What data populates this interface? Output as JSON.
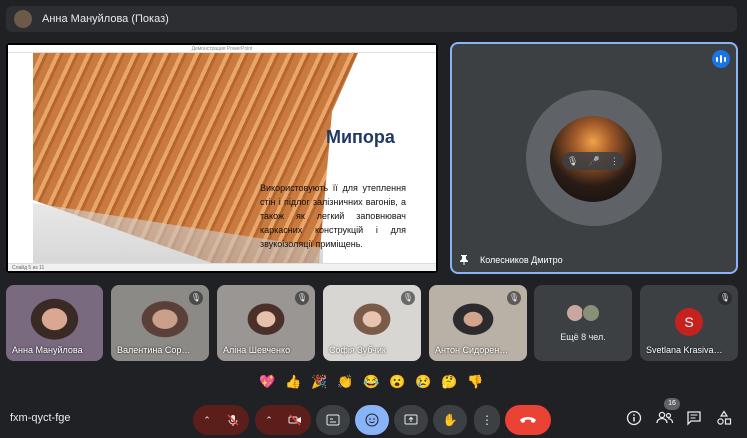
{
  "topbar": {
    "title": "Анна Мануйлова (Показ)"
  },
  "presentation": {
    "window_title": "Демонстрация PowerPoint",
    "slide_title": "Мипора",
    "slide_text": "Використовують її для утеплення стін і підлог залізничних вагонів, а також як легкий заповнювач каркасних конструкцій і для звукоізоляції приміщень.",
    "status_text": "Слайд 5 из 11"
  },
  "speaker": {
    "name": "Колесников Дмитро"
  },
  "participants": [
    {
      "name": "Анна Мануйлова",
      "muted": false
    },
    {
      "name": "Валентина Сор…",
      "muted": true
    },
    {
      "name": "Аліна Шевченко",
      "muted": true
    },
    {
      "name": "Софія Зубчик",
      "muted": true
    },
    {
      "name": "Антон Сидорен…",
      "muted": true
    },
    {
      "name": "Ещё 8 чел.",
      "muted": false
    },
    {
      "name": "Svetlana Krasiva…",
      "initial": "S",
      "muted": true
    }
  ],
  "reactions": [
    "💖",
    "👍",
    "🎉",
    "👏",
    "😂",
    "😮",
    "😢",
    "🤔",
    "👎"
  ],
  "bottombar": {
    "meeting_code": "fxm-qyct-fge",
    "people_count": "16"
  },
  "colors": {
    "accent": "#8ab4f8",
    "end_call": "#ea4335",
    "muted_bg": "#5c1e1b"
  }
}
